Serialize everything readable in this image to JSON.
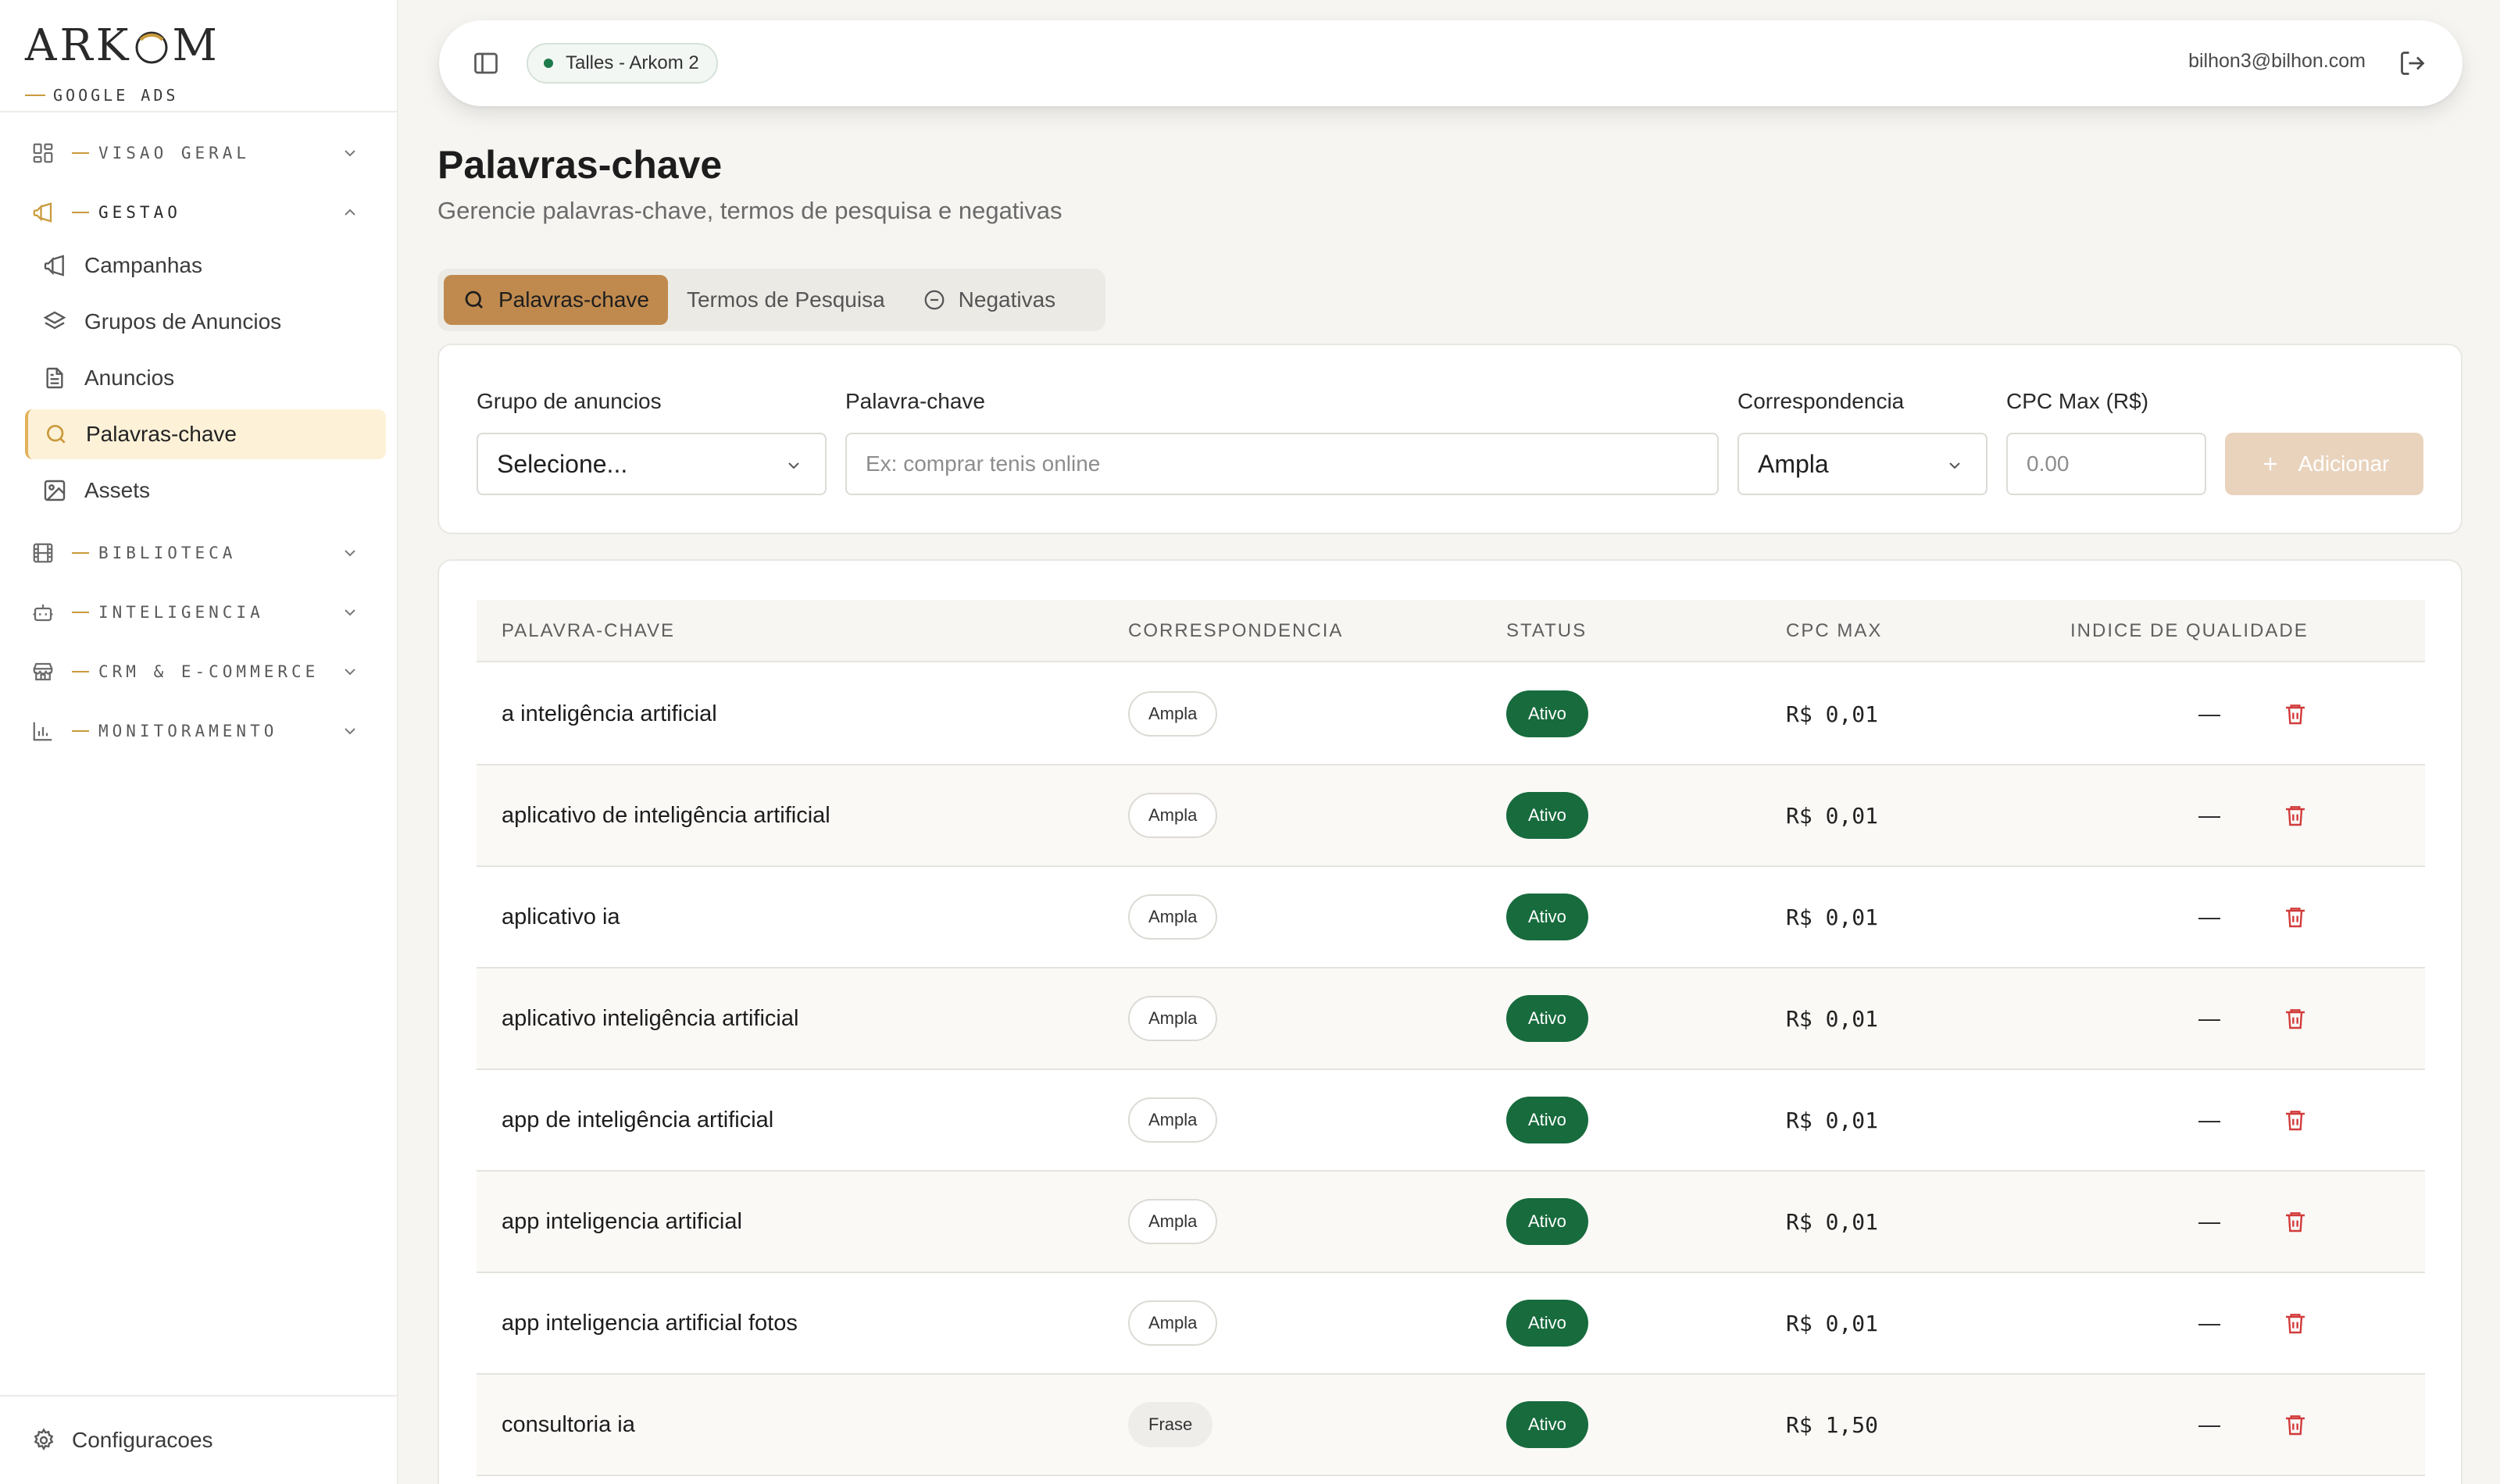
{
  "brand": {
    "name_left": "ARK",
    "name_right": "M",
    "subtitle": "GOOGLE ADS"
  },
  "sidebar": {
    "sections": [
      {
        "label": "VISAO GERAL",
        "icon": "grid-icon",
        "open": false
      },
      {
        "label": "GESTAO",
        "icon": "megaphone-icon",
        "open": true
      },
      {
        "label": "BIBLIOTECA",
        "icon": "film-icon",
        "open": false
      },
      {
        "label": "INTELIGENCIA",
        "icon": "bot-icon",
        "open": false
      },
      {
        "label": "CRM & E-COMMERCE",
        "icon": "store-icon",
        "open": false
      },
      {
        "label": "MONITORAMENTO",
        "icon": "bar-chart-icon",
        "open": false
      }
    ],
    "gestao_items": [
      {
        "label": "Campanhas",
        "icon": "megaphone-icon"
      },
      {
        "label": "Grupos de Anuncios",
        "icon": "layers-icon"
      },
      {
        "label": "Anuncios",
        "icon": "file-icon"
      },
      {
        "label": "Palavras-chave",
        "icon": "search-icon",
        "active": true
      },
      {
        "label": "Assets",
        "icon": "image-icon"
      }
    ],
    "settings_label": "Configuracoes"
  },
  "topbar": {
    "workspace": "Talles - Arkom 2",
    "workspace_status_color": "#1e7a4a",
    "user_email": "bilhon3@bilhon.com"
  },
  "page": {
    "title": "Palavras-chave",
    "subtitle": "Gerencie palavras-chave, termos de pesquisa e negativas"
  },
  "tabs": [
    {
      "label": "Palavras-chave",
      "icon": "search-icon",
      "active": true
    },
    {
      "label": "Termos de Pesquisa",
      "icon": "",
      "active": false
    },
    {
      "label": "Negativas",
      "icon": "minus-circle-icon",
      "active": false
    }
  ],
  "form": {
    "group_label": "Grupo de anuncios",
    "group_value": "Selecione...",
    "keyword_label": "Palavra-chave",
    "keyword_placeholder": "Ex: comprar tenis online",
    "match_label": "Correspondencia",
    "match_value": "Ampla",
    "cpc_label": "CPC Max (R$)",
    "cpc_placeholder": "0.00",
    "add_label": "Adicionar"
  },
  "table": {
    "headers": [
      "PALAVRA-CHAVE",
      "CORRESPONDENCIA",
      "STATUS",
      "CPC MAX",
      "INDICE DE QUALIDADE"
    ],
    "rows": [
      {
        "keyword": "a inteligência artificial",
        "match": "Ampla",
        "status": "Ativo",
        "cpc": "R$ 0,01",
        "quality": "—"
      },
      {
        "keyword": "aplicativo de inteligência artificial",
        "match": "Ampla",
        "status": "Ativo",
        "cpc": "R$ 0,01",
        "quality": "—"
      },
      {
        "keyword": "aplicativo ia",
        "match": "Ampla",
        "status": "Ativo",
        "cpc": "R$ 0,01",
        "quality": "—"
      },
      {
        "keyword": "aplicativo inteligência artificial",
        "match": "Ampla",
        "status": "Ativo",
        "cpc": "R$ 0,01",
        "quality": "—"
      },
      {
        "keyword": "app de inteligência artificial",
        "match": "Ampla",
        "status": "Ativo",
        "cpc": "R$ 0,01",
        "quality": "—"
      },
      {
        "keyword": "app inteligencia artificial",
        "match": "Ampla",
        "status": "Ativo",
        "cpc": "R$ 0,01",
        "quality": "—"
      },
      {
        "keyword": "app inteligencia artificial fotos",
        "match": "Ampla",
        "status": "Ativo",
        "cpc": "R$ 0,01",
        "quality": "—"
      },
      {
        "keyword": "consultoria ia",
        "match": "Frase",
        "status": "Ativo",
        "cpc": "R$ 1,50",
        "quality": "—"
      }
    ]
  },
  "colors": {
    "accent": "#c99a3b",
    "active_tab": "#c08a4e",
    "status_active": "#176b3d",
    "delete": "#d23b3b"
  }
}
